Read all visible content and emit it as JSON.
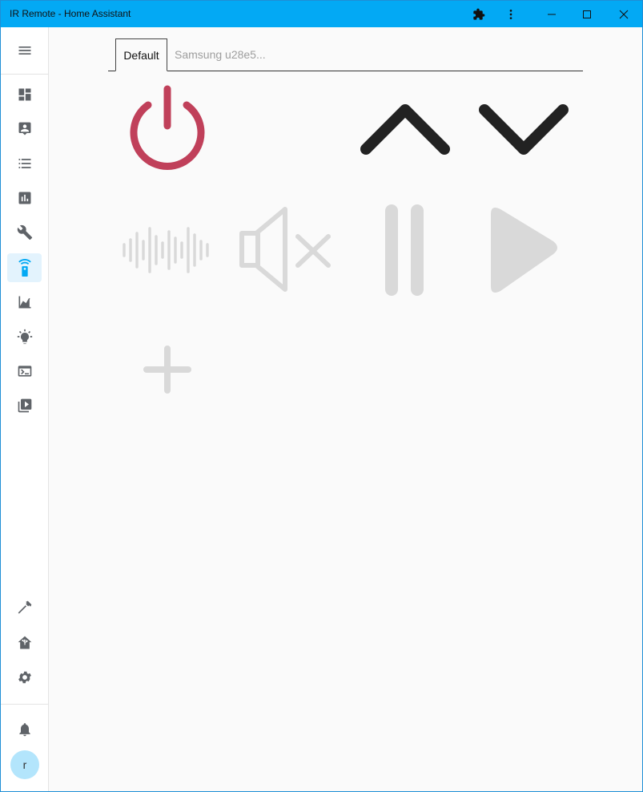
{
  "window": {
    "title": "IR Remote - Home Assistant"
  },
  "titlebar_icons": [
    "extensions-icon",
    "more-vert-icon",
    "minimize-icon",
    "maximize-icon",
    "close-icon"
  ],
  "sidebar": {
    "top_items": [
      {
        "name": "menu",
        "icon": "menu-icon"
      },
      {
        "name": "overview",
        "icon": "dashboard-icon"
      },
      {
        "name": "map",
        "icon": "account-box-icon"
      },
      {
        "name": "logbook",
        "icon": "list-icon"
      },
      {
        "name": "history",
        "icon": "bar-chart-icon"
      },
      {
        "name": "config",
        "icon": "wrench-icon"
      },
      {
        "name": "ir-remote",
        "icon": "remote-icon",
        "active": true
      },
      {
        "name": "energy",
        "icon": "area-chart-icon"
      },
      {
        "name": "lights",
        "icon": "lightbulb-icon"
      },
      {
        "name": "terminal",
        "icon": "terminal-icon"
      },
      {
        "name": "media",
        "icon": "media-icon"
      }
    ],
    "bottom_items": [
      {
        "name": "developer-tools",
        "icon": "hammer-icon"
      },
      {
        "name": "supervisor",
        "icon": "home-assistant-icon"
      },
      {
        "name": "settings",
        "icon": "gear-icon"
      },
      {
        "name": "notifications",
        "icon": "bell-icon"
      }
    ],
    "avatar_letter": "r"
  },
  "tabs": [
    {
      "label": "Default",
      "selected": true
    },
    {
      "label": "Samsung u28e5...",
      "selected": false
    }
  ],
  "remote_buttons": [
    {
      "name": "power",
      "icon": "power-icon",
      "color": "#c0405a"
    },
    {
      "name": "channel-up",
      "icon": "chevron-up-icon",
      "color": "#222222"
    },
    {
      "name": "channel-down",
      "icon": "chevron-down-icon",
      "color": "#222222"
    },
    {
      "name": "sound",
      "icon": "waveform-icon",
      "color": "#d9d9d9"
    },
    {
      "name": "mute",
      "icon": "volume-off-icon",
      "color": "#d9d9d9"
    },
    {
      "name": "pause",
      "icon": "pause-icon",
      "color": "#d9d9d9"
    },
    {
      "name": "play",
      "icon": "play-icon",
      "color": "#d9d9d9"
    },
    {
      "name": "add",
      "icon": "plus-icon",
      "color": "#d9d9d9"
    }
  ],
  "colors": {
    "titlebar": "#03a9f4",
    "sidebar_active_bg": "#e3f3fd",
    "sidebar_icon": "#5f6368",
    "active_icon": "#03a9f4",
    "avatar_bg": "#b3e5fc"
  }
}
